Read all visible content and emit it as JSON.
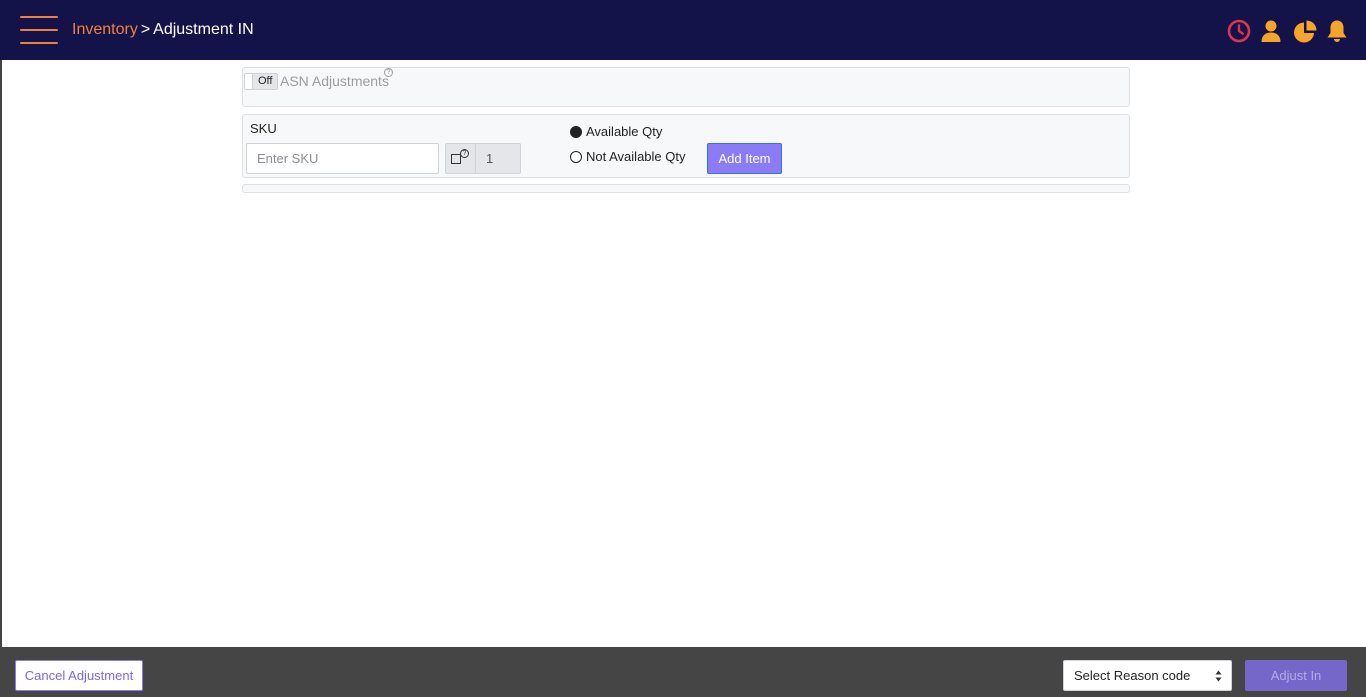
{
  "header": {
    "breadcrumb": {
      "parent": "Inventory",
      "separator": ">",
      "current": "Adjustment IN"
    },
    "icons": [
      "clock-icon",
      "user-icon",
      "pie-chart-icon",
      "bell-icon"
    ],
    "colors": {
      "background": "#13134a",
      "accent": "#f0803c",
      "clock": "#e0334f",
      "icons": "#f7a52a"
    }
  },
  "asn": {
    "toggle_label": "Off",
    "label": "ASN Adjustments",
    "help_mark": "?"
  },
  "sku_panel": {
    "label": "SKU",
    "input_placeholder": "Enter SKU",
    "input_value": "",
    "scan_help_mark": "?",
    "qty_value": "1",
    "radio_available": "Available Qty",
    "radio_not_available": "Not Available Qty",
    "selected_radio": "Available Qty",
    "add_button": "Add Item"
  },
  "footer": {
    "cancel_button": "Cancel Adjustment",
    "reason_select": "Select Reason code",
    "adjust_button": "Adjust In"
  }
}
